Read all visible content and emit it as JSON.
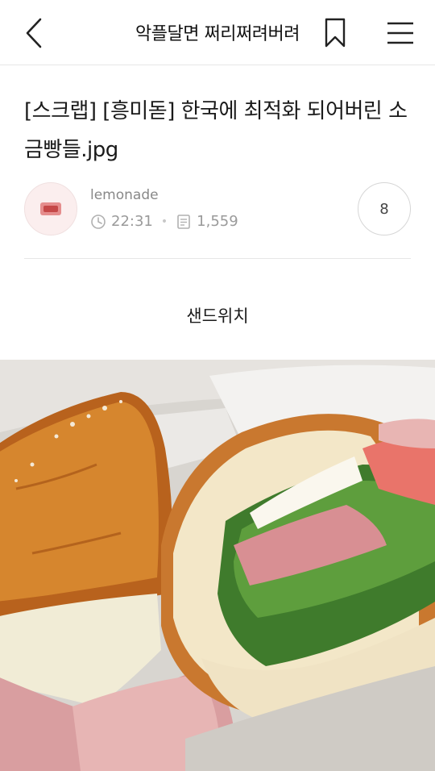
{
  "header": {
    "cafe_title": "악플달면 쩌리쩌려버려"
  },
  "post": {
    "title": "[스크랩] [흥미돋] 한국에 최적화 되어버린 소금빵들.jpg",
    "author": "lemonade",
    "time": "22:31",
    "views": "1,559",
    "comment_count": "8",
    "caption": "샌드위치"
  },
  "icons": {
    "back": "back-arrow-icon",
    "bookmark": "bookmark-icon",
    "menu": "hamburger-menu-icon",
    "clock": "clock-icon",
    "views": "document-icon"
  }
}
